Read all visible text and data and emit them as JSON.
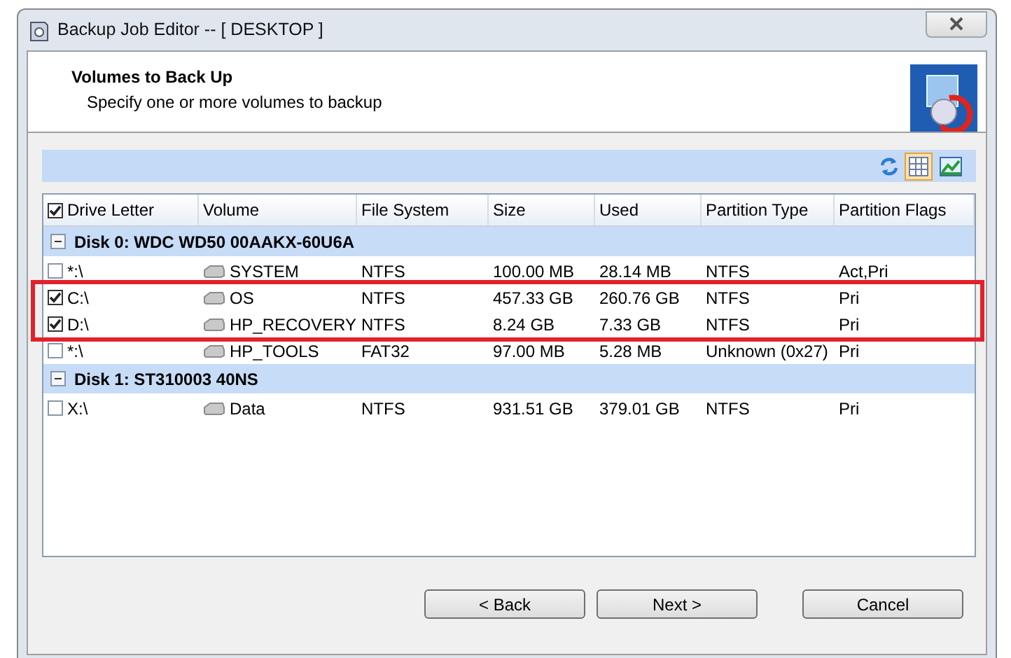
{
  "window": {
    "title": "Backup Job Editor -- [ DESKTOP ]"
  },
  "header": {
    "title": "Volumes to Back Up",
    "subtitle": "Specify one or more volumes to backup"
  },
  "view_buttons": [
    {
      "kind": "grid",
      "selected": true
    },
    {
      "kind": "chart",
      "selected": false
    }
  ],
  "table": {
    "select_all": {
      "checked": true
    },
    "columns": [
      "Drive Letter",
      "Volume",
      "File System",
      "Size",
      "Used",
      "Partition Type",
      "Partition Flags"
    ],
    "groups": [
      {
        "title": "Disk 0: WDC WD50 00AAKX-60U6A",
        "expanded": true,
        "rows": [
          {
            "checked": false,
            "highlighted": false,
            "cells": [
              "*:\\",
              "SYSTEM",
              "NTFS",
              "100.00 MB",
              "28.14 MB",
              "NTFS",
              "Act,Pri"
            ]
          },
          {
            "checked": true,
            "highlighted": true,
            "cells": [
              "C:\\",
              "OS",
              "NTFS",
              "457.33 GB",
              "260.76 GB",
              "NTFS",
              "Pri"
            ]
          },
          {
            "checked": true,
            "highlighted": true,
            "cells": [
              "D:\\",
              "HP_RECOVERY",
              "NTFS",
              "8.24 GB",
              "7.33 GB",
              "NTFS",
              "Pri"
            ]
          },
          {
            "checked": false,
            "highlighted": false,
            "cells": [
              "*:\\",
              "HP_TOOLS",
              "FAT32",
              "97.00 MB",
              "5.28 MB",
              "Unknown (0x27)",
              "Pri"
            ]
          }
        ]
      },
      {
        "title": "Disk 1: ST310003 40NS",
        "expanded": true,
        "rows": [
          {
            "checked": false,
            "highlighted": false,
            "cells": [
              "X:\\",
              "Data",
              "NTFS",
              "931.51 GB",
              "379.01 GB",
              "NTFS",
              "Pri"
            ]
          }
        ]
      }
    ]
  },
  "buttons": [
    {
      "label": "< Back"
    },
    {
      "label": "Next >"
    },
    {
      "label": "Cancel"
    }
  ]
}
